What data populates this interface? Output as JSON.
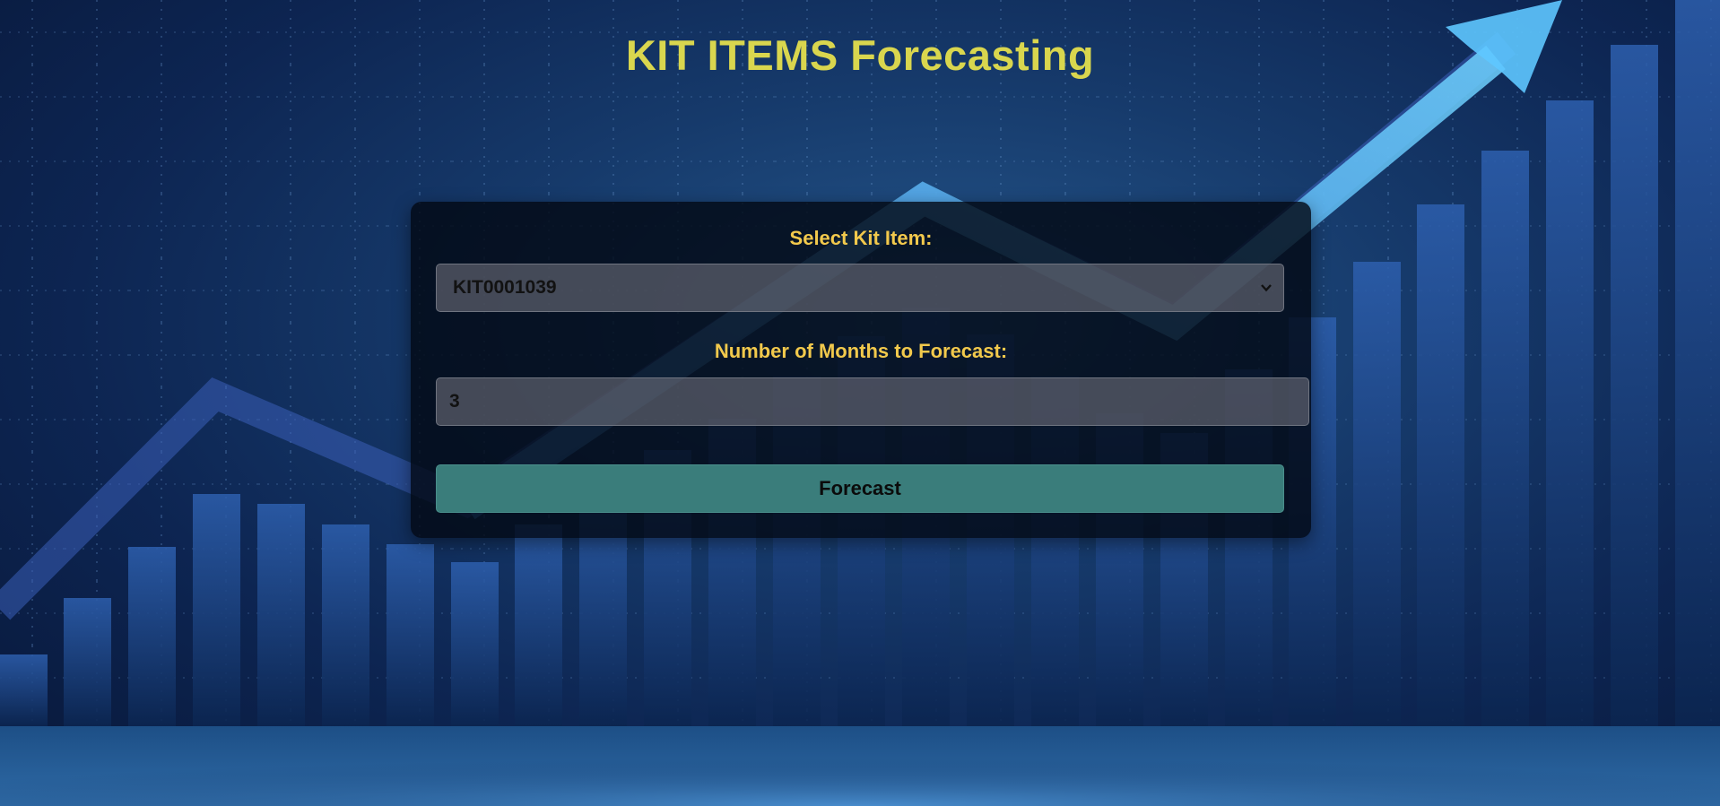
{
  "header": {
    "title": "KIT ITEMS Forecasting"
  },
  "form": {
    "kit_item_label": "Select Kit Item:",
    "kit_item_selected": "KIT0001039",
    "months_label": "Number of Months to Forecast:",
    "months_value": "3",
    "forecast_button_label": "Forecast"
  },
  "background": {
    "theme": "growth-chart-with-arrow",
    "arrow_icon": "trend-up-arrow-icon"
  },
  "colors": {
    "title": "#d9d64e",
    "labels": "#f2c94c",
    "button": "#3a7d7b",
    "panel": "#03081499"
  }
}
